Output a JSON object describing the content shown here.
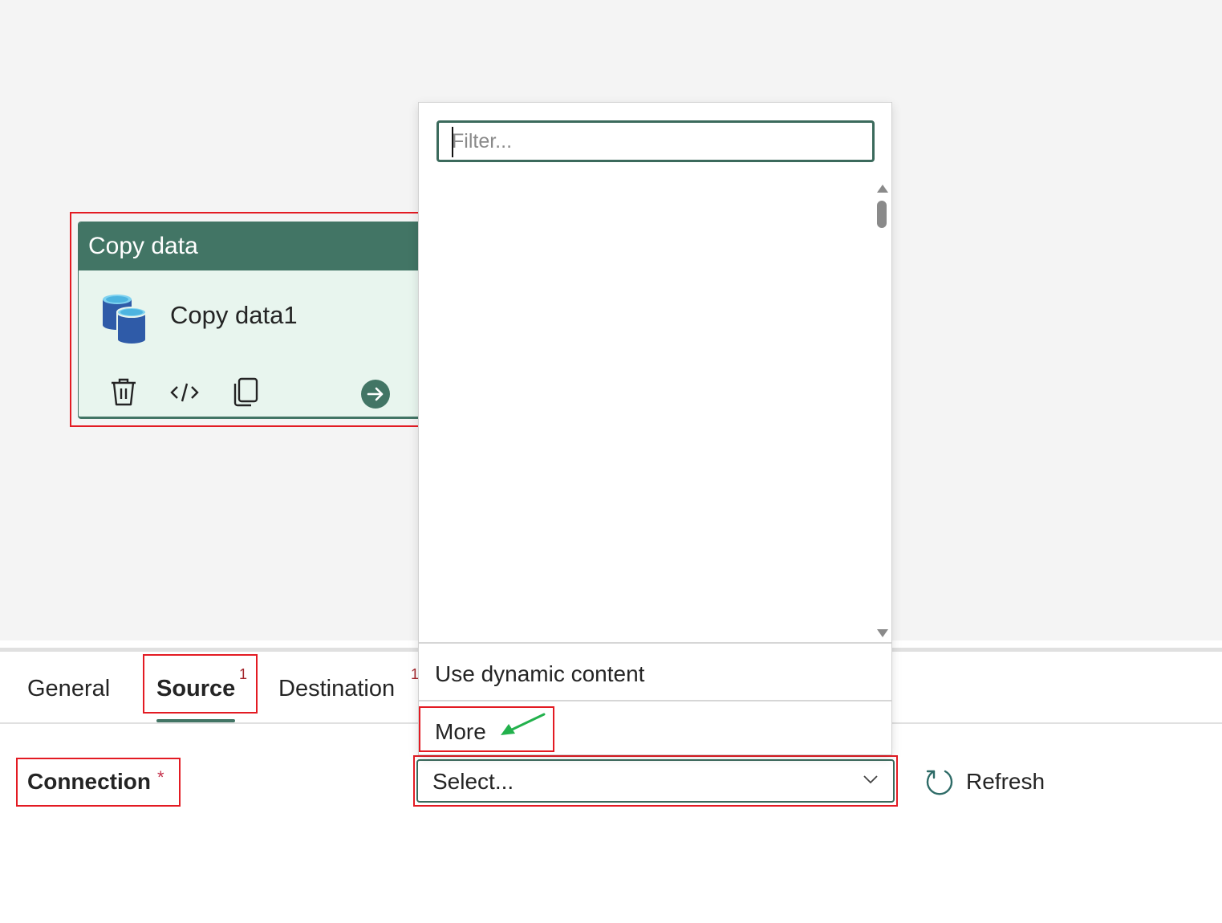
{
  "activity": {
    "type_label": "Copy data",
    "name": "Copy data1",
    "icons": {
      "activity": "database-copy-icon",
      "delete": "trash-icon",
      "code": "code-icon",
      "copy": "copy-icon",
      "go": "arrow-right-circle-icon"
    }
  },
  "dropdown": {
    "filter_placeholder": "Filter...",
    "filter_value": "",
    "options": [
      {
        "label": "Use dynamic content"
      },
      {
        "label": "More"
      }
    ]
  },
  "tabs": [
    {
      "label": "General",
      "badge": "",
      "active": false
    },
    {
      "label": "Source",
      "badge": "1",
      "active": true
    },
    {
      "label": "Destination",
      "badge": "1",
      "active": false
    }
  ],
  "connection": {
    "label": "Connection",
    "required_marker": "*",
    "select_value": "Select...",
    "refresh_label": "Refresh"
  },
  "colors": {
    "accent": "#427565",
    "card_bg": "#e8f5ee",
    "annotation": "#e31b23",
    "pointer_arrow": "#22b14c",
    "badge": "#a4262c"
  }
}
